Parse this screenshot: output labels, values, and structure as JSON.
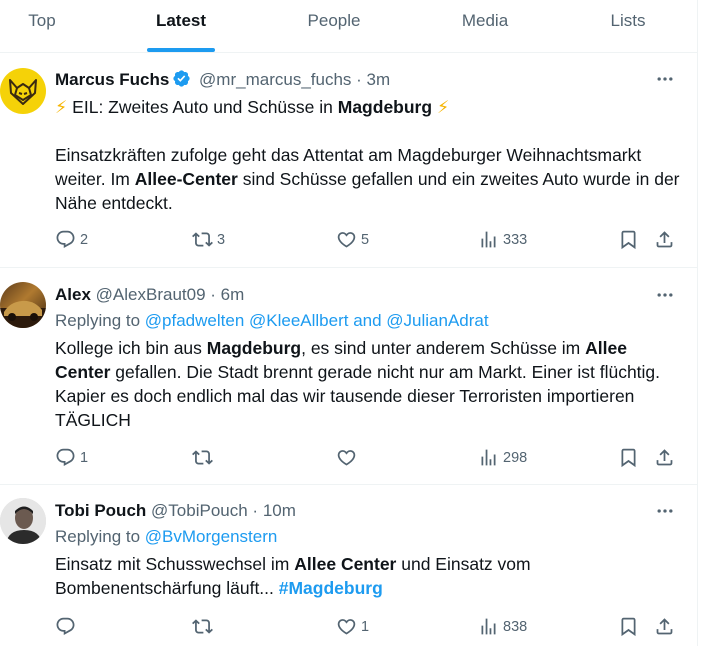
{
  "tabs": [
    {
      "label": "Top",
      "active": false
    },
    {
      "label": "Latest",
      "active": true
    },
    {
      "label": "People",
      "active": false
    },
    {
      "label": "Media",
      "active": false
    },
    {
      "label": "Lists",
      "active": false
    }
  ],
  "colors": {
    "accent": "#1d9bf0",
    "text": "#0f1419",
    "muted": "#536471",
    "avatar_yellow": "#f5d208"
  },
  "tweets": [
    {
      "name": "Marcus Fuchs",
      "verified": true,
      "handle": "@mr_marcus_fuchs",
      "dot": "·",
      "time": "3m",
      "line1_bolt_left": "⚡",
      "line1_text": "EIL: Zweites Auto und Schüsse in ",
      "line1_bold": "Magdeburg",
      "line1_bolt_right": "⚡",
      "body_p1": "Einsatzkräften zufolge geht das Attentat am Magdeburger Weihnachtsmarkt weiter. Im ",
      "body_bold": "Allee-Center",
      "body_p2": " sind Schüsse gefallen und ein zweites Auto wurde in der Nähe entdeckt.",
      "replies": "2",
      "reposts": "3",
      "likes": "5",
      "views": "333"
    },
    {
      "name": "Alex",
      "handle": "@AlexBraut09",
      "dot": "·",
      "time": "6m",
      "replying_label": "Replying to",
      "replying_to": "@pfadwelten @KleeAllbert and @JulianAdrat",
      "t1": "Kollege ich bin aus ",
      "b1": "Magdeburg",
      "t2": ", es sind unter anderem Schüsse im ",
      "b2": "Allee Center",
      "t3": " gefallen. Die Stadt brennt gerade nicht nur am Markt. Einer ist flüchtig. Kapier es doch endlich mal das wir tausende dieser Terroristen importieren TÄGLICH",
      "replies": "1",
      "reposts": "",
      "likes": "",
      "views": "298"
    },
    {
      "name": "Tobi Pouch",
      "handle": "@TobiPouch",
      "dot": "·",
      "time": "10m",
      "replying_label": "Replying to",
      "replying_to": "@BvMorgenstern",
      "t1": "Einsatz mit Schusswechsel im ",
      "b1": "Allee Center",
      "t2": " und Einsatz vom Bombenentschärfung läuft... ",
      "hashtag": "#Magdeburg",
      "replies": "",
      "reposts": "",
      "likes": "1",
      "views": "838"
    }
  ]
}
